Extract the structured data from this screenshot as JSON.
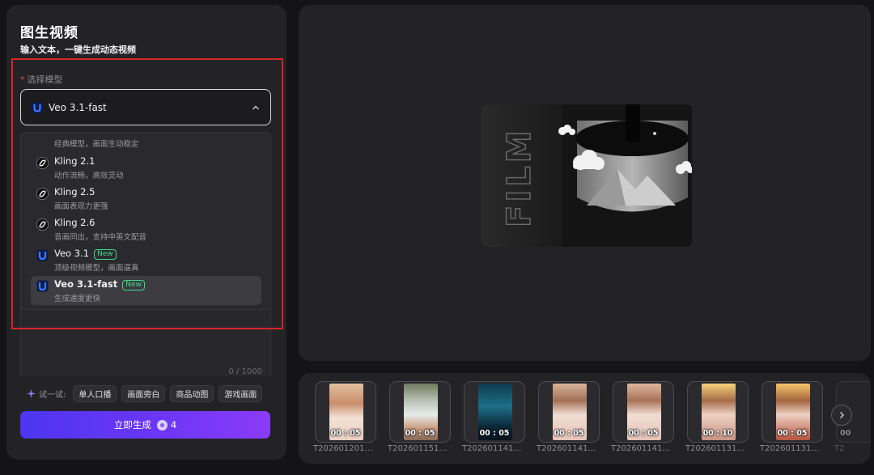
{
  "header": {
    "title": "图生视频",
    "subtitle": "输入文本，一键生成动态视频"
  },
  "model_field": {
    "label": "选择模型",
    "required_mark": "*",
    "selected": "Veo 3.1-fast"
  },
  "dropdown": {
    "partial_item_desc": "经典模型，画面生动稳定",
    "items": [
      {
        "name": "Kling 2.1",
        "desc": "动作流畅，高效灵动",
        "icon": "kling-icon",
        "badge": ""
      },
      {
        "name": "Kling 2.5",
        "desc": "画面表现力更强",
        "icon": "kling-icon",
        "badge": ""
      },
      {
        "name": "Kling 2.6",
        "desc": "音画同出，支持中英文配音",
        "icon": "kling-icon",
        "badge": ""
      },
      {
        "name": "Veo 3.1",
        "desc": "顶级视频模型，画面逼真",
        "icon": "veo-icon",
        "badge": "New"
      },
      {
        "name": "Veo 3.1-fast",
        "desc": "生成速度更快",
        "icon": "veo-icon",
        "badge": "New"
      }
    ]
  },
  "prompt": {
    "char_count": "0 / 1000"
  },
  "suggestions": {
    "label": "试一试:",
    "chips": [
      "单人口播",
      "画面旁白",
      "商品动图",
      "游戏画面"
    ]
  },
  "generate": {
    "label": "立即生成",
    "cost": "4"
  },
  "preview": {
    "film_text": "FILM"
  },
  "history": [
    {
      "duration": "00 : 05",
      "name": "T202601201…"
    },
    {
      "duration": "00 : 05",
      "name": "T202601151…"
    },
    {
      "duration": "00 : 05",
      "name": "T202601141…"
    },
    {
      "duration": "00 : 05",
      "name": "T202601141…"
    },
    {
      "duration": "00 : 05",
      "name": "T202601141…"
    },
    {
      "duration": "00 : 10",
      "name": "T202601131…"
    },
    {
      "duration": "00 : 05",
      "name": "T202601131…"
    },
    {
      "duration": "00",
      "name": "T2"
    }
  ],
  "colors": {
    "accent_start": "#4d35f0",
    "accent_end": "#8b3bf8",
    "new_badge": "#3fd98a",
    "highlight_box": "#d8242a"
  }
}
